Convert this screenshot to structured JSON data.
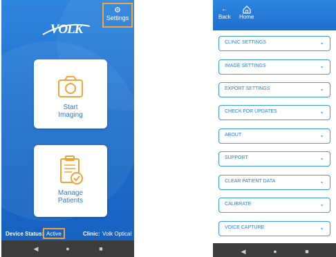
{
  "left_screen": {
    "settings_label": "Settings",
    "logo_text": "VOLK",
    "start_card": {
      "line1": "Start",
      "line2": "Imaging",
      "icon": "camera-icon"
    },
    "manage_card": {
      "line1": "Manage",
      "line2": "Patients",
      "icon": "clipboard-check-icon"
    },
    "device_status_label": "Device Status:",
    "device_status_value": "Active",
    "clinic_label": "Clinic:",
    "clinic_value": "Volk Optical",
    "nav": {
      "back": "◀",
      "home": "●",
      "recent": "■"
    }
  },
  "right_screen": {
    "back_label": "Back",
    "home_label": "Home",
    "menu_items": [
      "CLINIC SETTINGS",
      "IMAGE SETTINGS",
      "EXPORT SETTINGS",
      "CHECK FOR UPDATES",
      "ABOUT",
      "SUPPORT",
      "CLEAR PATIENT DATA",
      "CALIBRATE",
      "VOICE CAPTURE"
    ],
    "chevron": "⌄",
    "nav": {
      "back": "◀",
      "home": "●",
      "recent": "■"
    }
  },
  "colors": {
    "accent_blue": "#2a7bd6",
    "highlight_orange": "#f2a233",
    "nav_bar": "#3c3c3c"
  }
}
